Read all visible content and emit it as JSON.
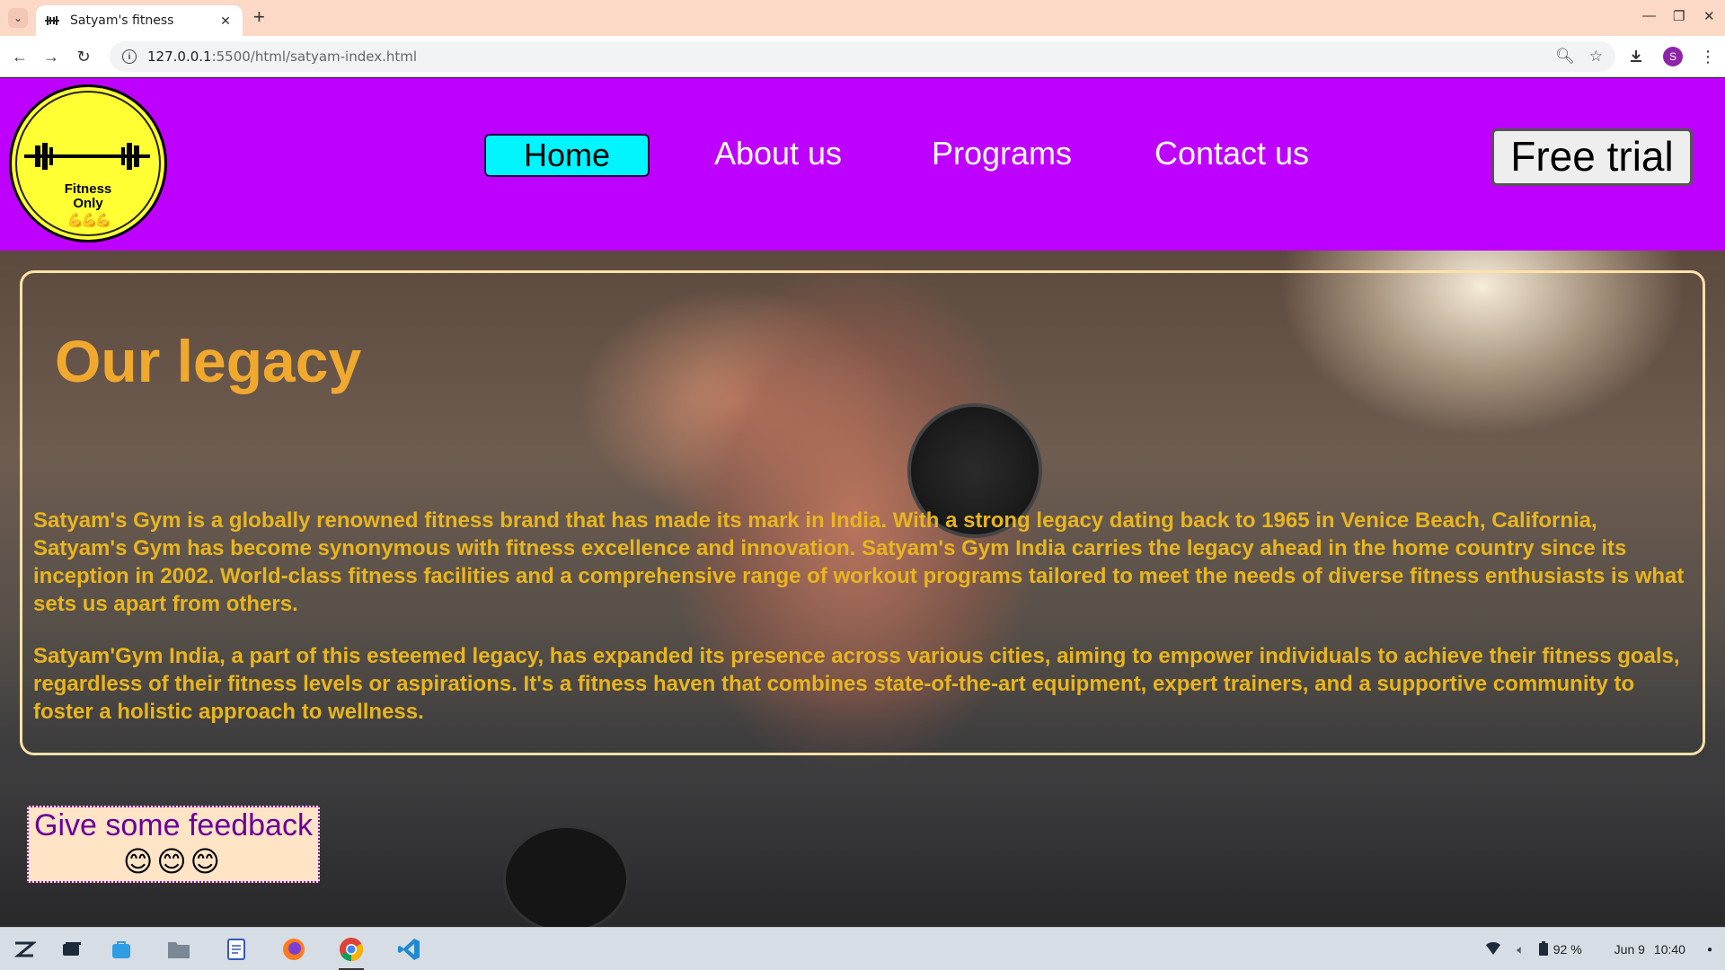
{
  "browser": {
    "tab_title": "Satyam's fitness",
    "url_host": "127.0.0.1",
    "url_path": ":5500/html/satyam-index.html",
    "profile_initial": "S"
  },
  "header": {
    "logo_line1": "Fitness",
    "logo_line2": "Only",
    "logo_emoji": "💪💪💪",
    "nav": [
      "Home",
      "About us",
      "Programs",
      "Contact us"
    ],
    "active_nav": "Home",
    "cta": "Free trial"
  },
  "legacy": {
    "title": "Our legacy",
    "paragraph1": "Satyam's Gym is a globally renowned fitness brand that has made its mark in India. With a strong legacy dating back to 1965 in Venice Beach, California, Satyam's Gym has become synonymous with fitness excellence and innovation. Satyam's Gym India carries the legacy ahead in the home country since its inception in 2002. World-class fitness facilities and a comprehensive range of workout programs tailored to meet the needs of diverse fitness enthusiasts is what sets us apart from others.",
    "paragraph2": "Satyam'Gym India, a part of this esteemed legacy, has expanded its presence across various cities, aiming to empower individuals to achieve their fitness goals, regardless of their fitness levels or aspirations. It's a fitness haven that combines state-of-the-art equipment, expert trainers, and a supportive community to foster a holistic approach to wellness."
  },
  "feedback": {
    "text": "Give some feedback",
    "emoji": "😊😊😊"
  },
  "taskbar": {
    "battery": "92 %",
    "date": "Jun 9",
    "time": "10:40"
  },
  "colors": {
    "header_bg": "#be00ff",
    "active_nav_bg": "#00f5ff",
    "legacy_title": "#f0a92e",
    "legacy_text": "#e8b51f",
    "logo_bg": "#ffff33"
  }
}
